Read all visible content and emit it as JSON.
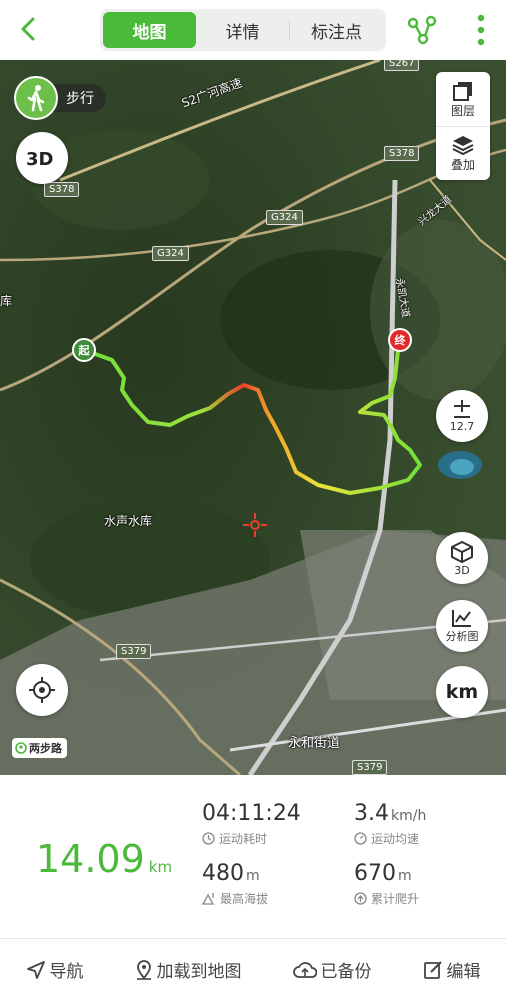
{
  "tabs": [
    {
      "label": "地图",
      "active": true
    },
    {
      "label": "详情",
      "active": false
    },
    {
      "label": "标注点",
      "active": false
    }
  ],
  "map": {
    "mode_label": "步行",
    "layers_label": "图层",
    "overlay_label": "叠加",
    "zoom_level": "12.7",
    "btn_3d_label": "3D",
    "analysis_label": "分析图",
    "unit_label": "km",
    "start_marker": "起",
    "end_marker": "终",
    "brand": "两步路",
    "place_labels": {
      "expressway": "S2广河高速",
      "reservoir": "水声水库",
      "street": "永和街道",
      "left_edge": "库",
      "xinglong": "兴龙大道",
      "yongkai": "永凯大道"
    },
    "road_tags": {
      "s378_left": "S378",
      "s378_right": "S378",
      "g324_a": "G324",
      "g324_b": "G324",
      "s379_a": "S379",
      "s379_b": "S379",
      "s267": "S267"
    }
  },
  "stats": {
    "distance_value": "14.09",
    "distance_unit": "km",
    "duration_value": "04:11:24",
    "duration_label": "运动耗时",
    "speed_value": "3.4",
    "speed_unit": "km/h",
    "speed_label": "运动均速",
    "altitude_value": "480",
    "altitude_unit": "m",
    "altitude_label": "最高海拔",
    "climb_value": "670",
    "climb_unit": "m",
    "climb_label": "累计爬升"
  },
  "bottom": {
    "navigate": "导航",
    "load_to_map": "加载到地图",
    "backed_up": "已备份",
    "edit": "编辑"
  },
  "colors": {
    "accent": "#4bb93a",
    "track_low": "#5fe03a",
    "track_high": "#e8402a",
    "end_marker": "#e02a2a"
  }
}
